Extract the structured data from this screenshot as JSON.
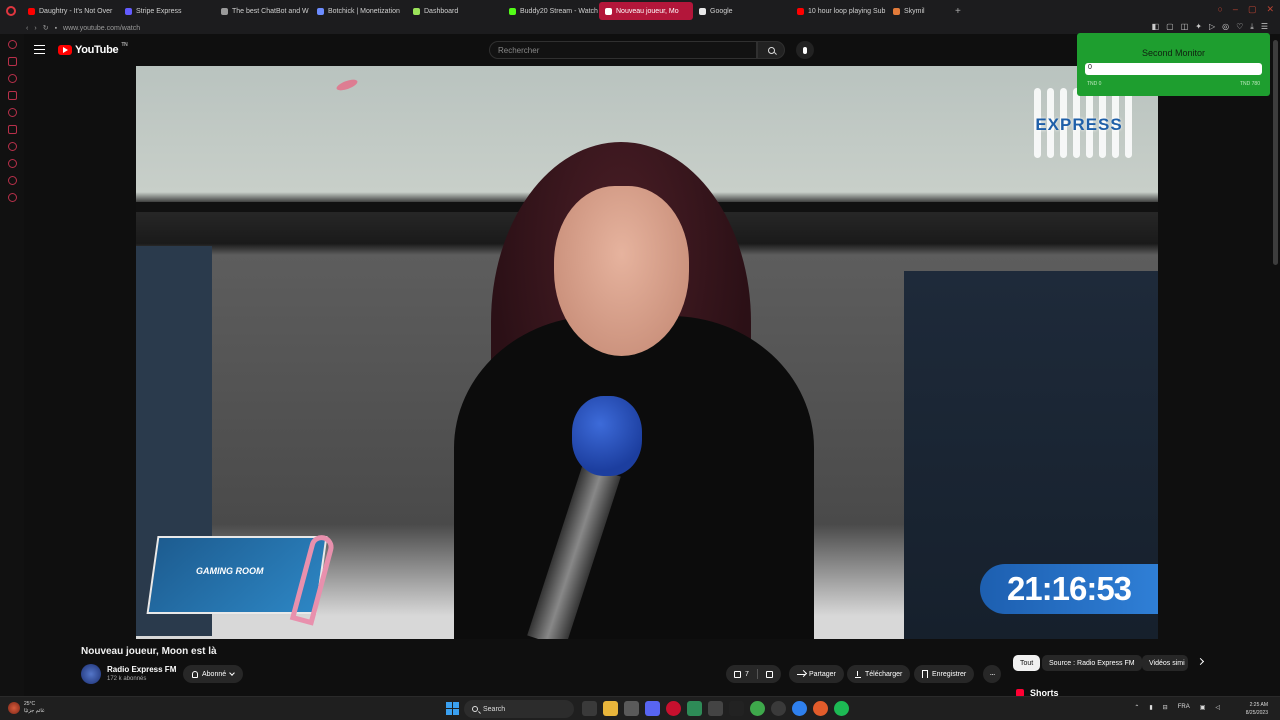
{
  "browser": {
    "tabs": [
      {
        "label": "Daughtry - It's Not Over",
        "icon": "youtube-favicon",
        "color": "#ff0000",
        "active": false
      },
      {
        "label": "Stripe Express",
        "icon": "stripe-favicon",
        "color": "#635bff",
        "active": false
      },
      {
        "label": "The best ChatBot and W",
        "icon": "chatbot-favicon",
        "color": "#9a9a9a",
        "active": false
      },
      {
        "label": "Botchick | Monetization",
        "icon": "botchick-favicon",
        "color": "#6c8cff",
        "active": false
      },
      {
        "label": "Dashboard",
        "icon": "dashboard-favicon",
        "color": "#9be35a",
        "active": false
      },
      {
        "label": "Buddy20 Stream - Watch",
        "icon": "kick-favicon",
        "color": "#53fc18",
        "active": false
      },
      {
        "label": "Nouveau joueur, Mo",
        "icon": "youtube-favicon",
        "color": "#ffffff",
        "active": true
      },
      {
        "label": "Google",
        "icon": "google-favicon",
        "color": "#e8e8e8",
        "active": false
      },
      {
        "label": "10 hour loop playing Sub",
        "icon": "youtube-favicon",
        "color": "#ff0000",
        "active": false
      },
      {
        "label": "Skymil",
        "icon": "skymil-favicon",
        "color": "#e27b3a",
        "active": false
      }
    ],
    "url": "www.youtube.com/watch",
    "accent": "#b3163a"
  },
  "youtube": {
    "logo_text": "YouTube",
    "logo_tm": "TN",
    "search_placeholder": "Rechercher"
  },
  "video": {
    "overlay_logo": "EXPRESS",
    "clock": "21:16:53",
    "badge_text": "GAMING ROOM",
    "title": "Nouveau joueur, Moon est là"
  },
  "channel": {
    "name": "Radio Express FM",
    "subscribers": "172 k abonnés",
    "subscribe_label": "Abonné"
  },
  "actions": {
    "likes": "7",
    "share": "Partager",
    "download": "Télécharger",
    "save": "Enregistrer",
    "more": "···"
  },
  "chips": {
    "all": "Tout",
    "source": "Source : Radio Express FM",
    "similar": "Vidéos simi"
  },
  "shorts_label": "Shorts",
  "monitor": {
    "title": "Second Monitor",
    "value": "0",
    "min_label": "TND 0",
    "max_label": "TND 780",
    "color": "#1e9e2f"
  },
  "taskbar": {
    "weather_temp": "25°C",
    "weather_desc": "غائم جزئيًا",
    "search_label": "Search",
    "lang": "FRA",
    "time": "2:25 AM",
    "date": "8/25/2023"
  }
}
